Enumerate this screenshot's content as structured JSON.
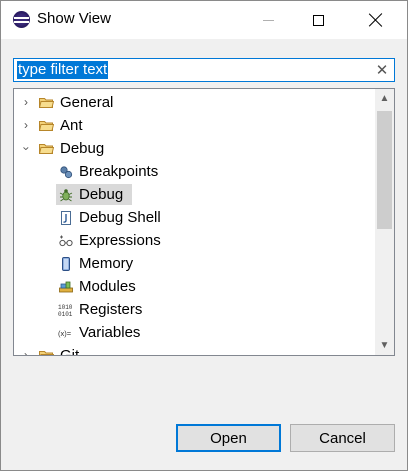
{
  "window": {
    "title": "Show View"
  },
  "filter": {
    "value": "type filter text"
  },
  "tree": {
    "items": [
      {
        "label": "General",
        "kind": "folder",
        "expanded": false
      },
      {
        "label": "Ant",
        "kind": "folder",
        "expanded": false
      },
      {
        "label": "Debug",
        "kind": "folder",
        "expanded": true
      },
      {
        "label": "Breakpoints",
        "kind": "view",
        "icon": "breakpoints-icon"
      },
      {
        "label": "Debug",
        "kind": "view",
        "icon": "bug-icon",
        "selected": true
      },
      {
        "label": "Debug Shell",
        "kind": "view",
        "icon": "debug-shell-icon"
      },
      {
        "label": "Expressions",
        "kind": "view",
        "icon": "expressions-icon"
      },
      {
        "label": "Memory",
        "kind": "view",
        "icon": "memory-icon"
      },
      {
        "label": "Modules",
        "kind": "view",
        "icon": "modules-icon"
      },
      {
        "label": "Registers",
        "kind": "view",
        "icon": "registers-icon"
      },
      {
        "label": "Variables",
        "kind": "view",
        "icon": "variables-icon"
      },
      {
        "label": "Git",
        "kind": "folder",
        "expanded": false
      }
    ]
  },
  "buttons": {
    "open": "Open",
    "cancel": "Cancel"
  },
  "colors": {
    "accent": "#0078d7",
    "selection": "#d9d9d9",
    "folder": "#e8b54a"
  }
}
